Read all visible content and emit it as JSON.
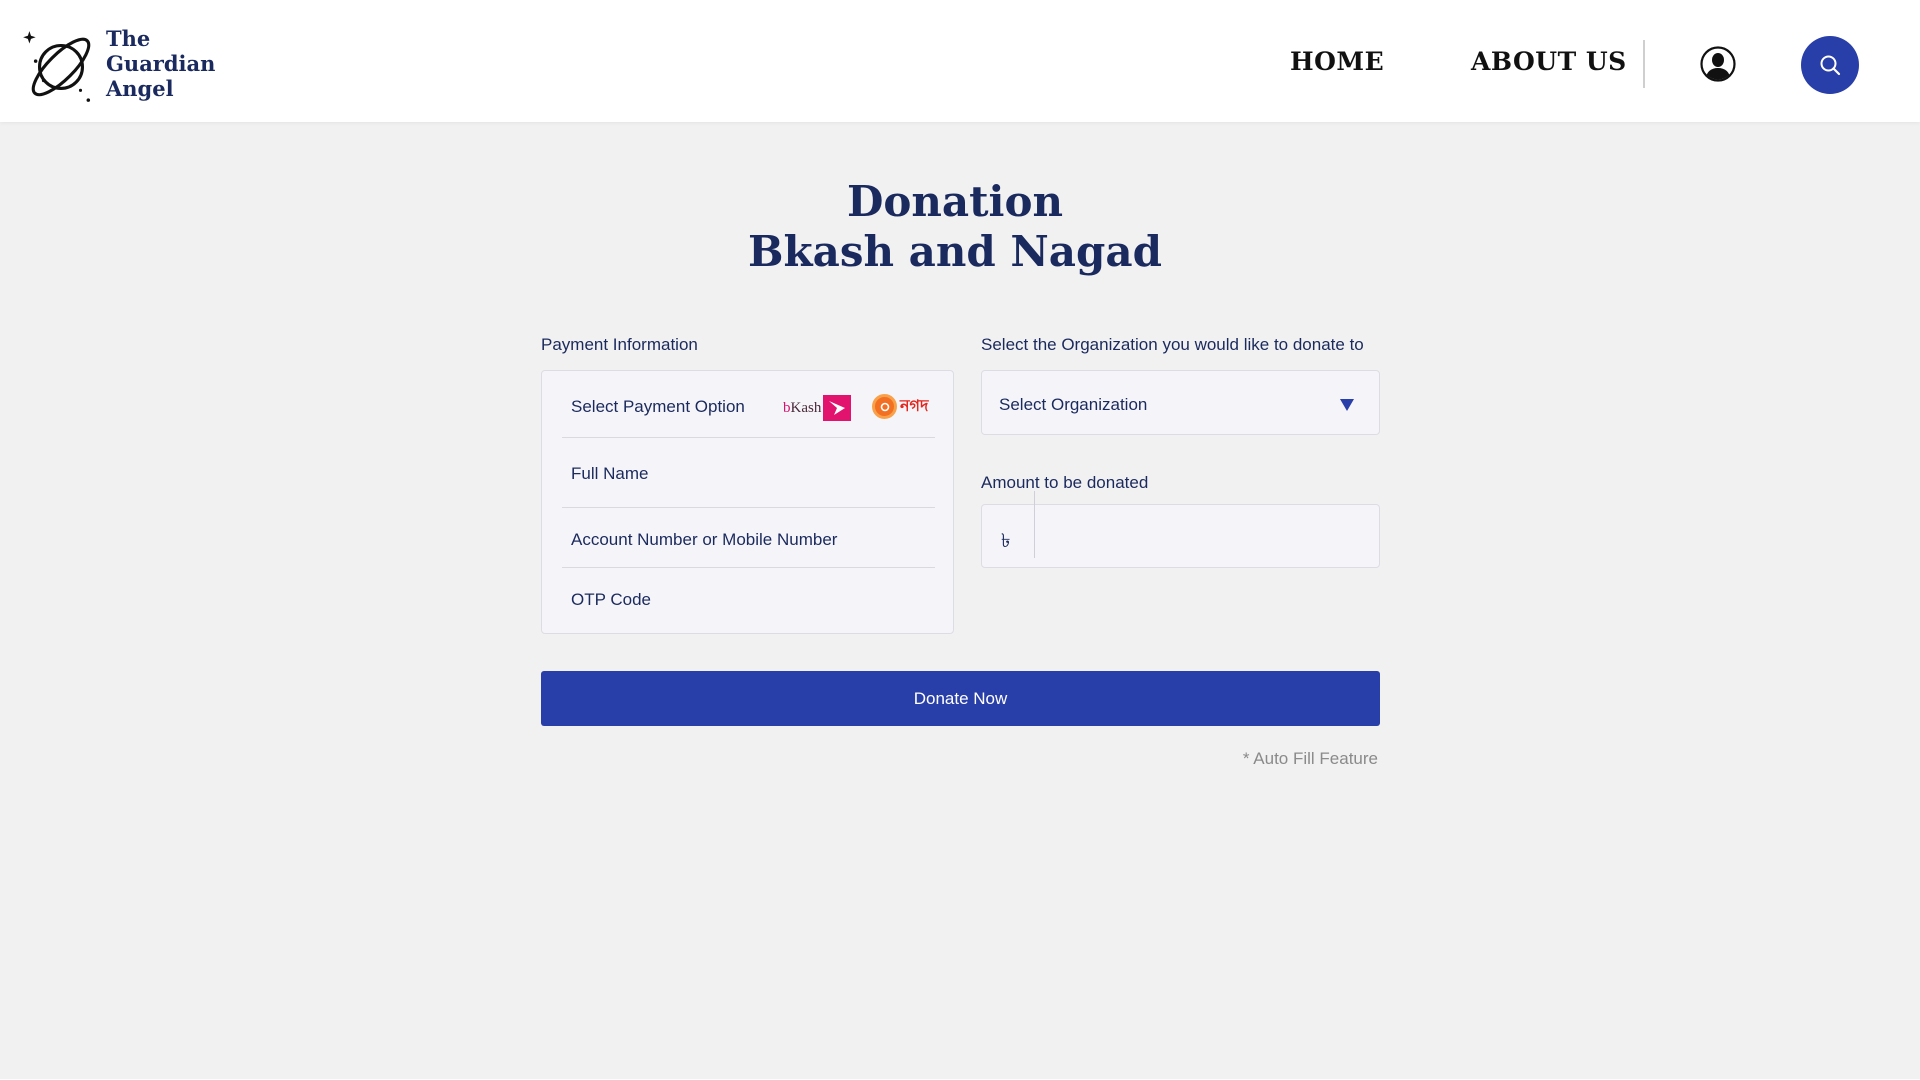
{
  "header": {
    "logo": {
      "line1": "The",
      "line2": "Guardian",
      "line3": "Angel",
      "icon": "planet-logo-icon"
    },
    "nav": {
      "home": "HOME",
      "about": "ABOUT US"
    },
    "profile_icon": "user-profile-icon",
    "search_icon": "search-icon"
  },
  "page": {
    "title_line1": "Donation",
    "title_line2": "Bkash and Nagad"
  },
  "payment": {
    "label": "Payment Information",
    "select_option": "Select Payment Option",
    "full_name": "Full Name",
    "account_number": "Account Number or Mobile Number",
    "otp_code": "OTP Code",
    "bkash_prefix": "b",
    "bkash_rest": "Kash",
    "nagad_text": "নগদ"
  },
  "organization": {
    "label": "Select the Organization you would like to donate to",
    "placeholder": "Select Organization"
  },
  "amount": {
    "label": "Amount to be donated",
    "currency_symbol": "৳",
    "value": ""
  },
  "actions": {
    "donate_label": "Donate Now",
    "autofill_note": "* Auto Fill Feature"
  },
  "colors": {
    "primary": "#283ea8",
    "navy_text": "#1b2a5e",
    "background": "#f1f1f1",
    "bkash_pink": "#e2136e",
    "nagad_red": "#e4251c"
  }
}
